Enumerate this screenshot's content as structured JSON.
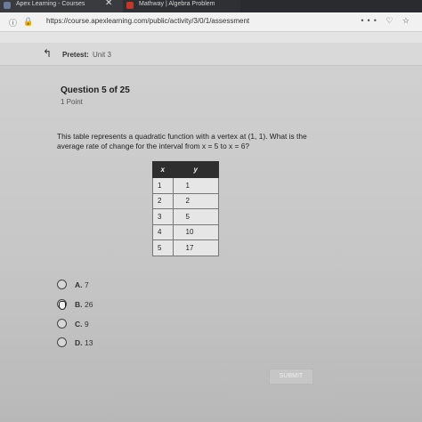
{
  "browser": {
    "tabs": [
      {
        "label": "Apex Learning - Courses"
      },
      {
        "label": "Mathway | Algebra Problem"
      }
    ],
    "close_glyph": "✕",
    "plus_glyph": "+",
    "url": "https://course.apexlearning.com/public/activity/3/0/1/assessment",
    "right_icons": "••• ♡ ☆"
  },
  "header": {
    "back_icon": "↰",
    "label": "Pretest:",
    "unit": "Unit 3"
  },
  "question": {
    "title": "Question 5 of 25",
    "points": "1 Point",
    "text": "This table represents a quadratic function with a vertex at (1, 1). What is the average rate of change for the interval from x = 5 to x = 6?"
  },
  "table": {
    "headers": [
      "x",
      "y"
    ],
    "rows": [
      [
        "1",
        "1"
      ],
      [
        "2",
        "2"
      ],
      [
        "3",
        "5"
      ],
      [
        "4",
        "10"
      ],
      [
        "5",
        "17"
      ]
    ]
  },
  "options": [
    {
      "letter": "A.",
      "value": "7",
      "selected": false
    },
    {
      "letter": "B.",
      "value": "26",
      "selected": true
    },
    {
      "letter": "C.",
      "value": "9",
      "selected": false
    },
    {
      "letter": "D.",
      "value": "13",
      "selected": false
    }
  ],
  "submit_label": "SUBMIT"
}
